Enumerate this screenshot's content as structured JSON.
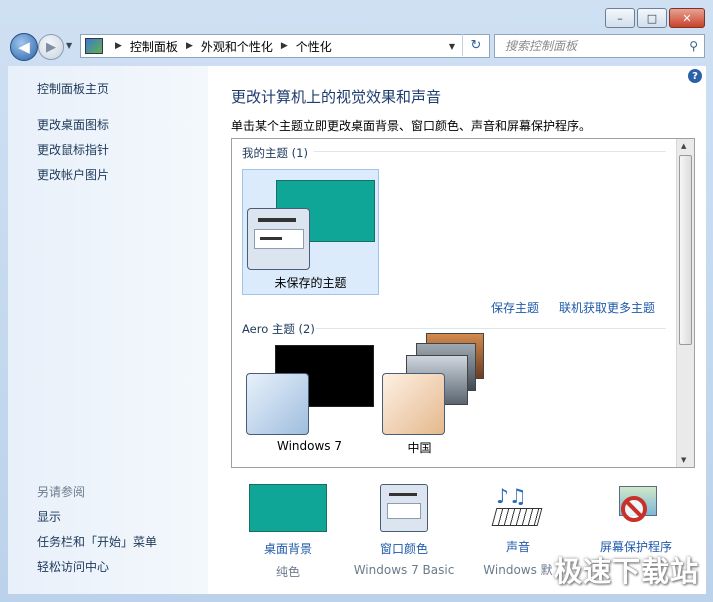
{
  "window": {
    "buttons": {
      "minimize": "–",
      "maximize": "□",
      "close": "✕"
    }
  },
  "nav": {
    "back_glyph": "◀",
    "forward_glyph": "▶",
    "dropdown_glyph": "▼",
    "breadcrumb": [
      "控制面板",
      "外观和个性化",
      "个性化"
    ],
    "breadcrumb_sep": "▶",
    "refresh_glyph": "↻",
    "search_placeholder": "搜索控制面板",
    "search_glyph": "⚲"
  },
  "sidebar": {
    "items": [
      "控制面板主页",
      "更改桌面图标",
      "更改鼠标指针",
      "更改帐户图片"
    ],
    "see_also_title": "另请参阅",
    "see_also": [
      "显示",
      "任务栏和「开始」菜单",
      "轻松访问中心"
    ]
  },
  "main": {
    "help_glyph": "?",
    "heading": "更改计算机上的视觉效果和声音",
    "subtitle": "单击某个主题立即更改桌面背景、窗口颜色、声音和屏幕保护程序。",
    "my_themes_header": "我的主题 (1)",
    "my_themes": [
      {
        "name": "未保存的主题"
      }
    ],
    "save_theme_link": "保存主题",
    "get_more_link": "联机获取更多主题",
    "aero_header": "Aero 主题 (2)",
    "aero_themes": [
      {
        "name": "Windows 7"
      },
      {
        "name": "中国"
      }
    ]
  },
  "bottom": {
    "items": [
      {
        "name": "桌面背景",
        "value": "纯色"
      },
      {
        "name": "窗口颜色",
        "value": "Windows 7 Basic"
      },
      {
        "name": "声音",
        "value": "Windows 默"
      },
      {
        "name": "屏幕保护程序",
        "value": ""
      }
    ]
  },
  "watermark": "极速下载站",
  "colors": {
    "accent_teal": "#0fa597",
    "link_blue": "#1f59a9",
    "heading_blue": "#1e3c6e"
  }
}
